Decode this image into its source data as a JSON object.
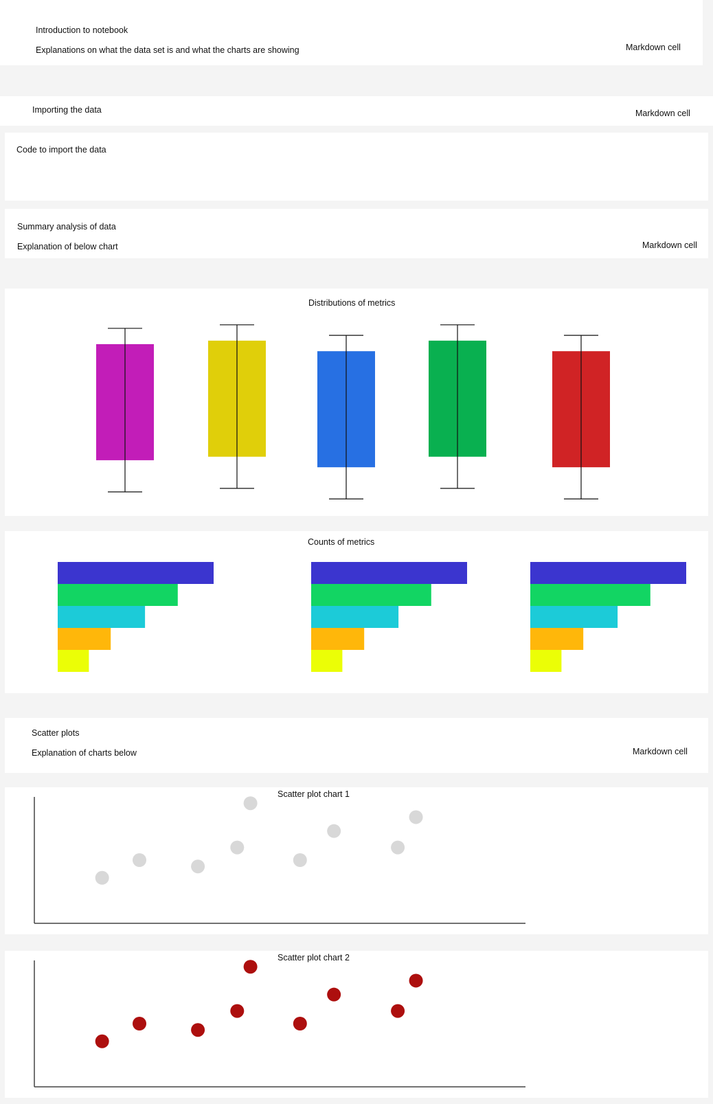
{
  "cells": {
    "intro": {
      "title": "Introduction to notebook",
      "body": "Explanations on what the data set is and what the charts are showing",
      "cell_type": "Markdown cell"
    },
    "import_md": {
      "title": "Importing the data",
      "cell_type": "Markdown cell"
    },
    "import_code": {
      "body": "Code to import the data"
    },
    "summary": {
      "title": "Summary analysis of data",
      "body": "Explanation of below chart",
      "cell_type": "Markdown cell"
    },
    "scatter_md": {
      "title": "Scatter plots",
      "body": "Explanation of charts below",
      "cell_type": "Markdown cell"
    }
  },
  "chart_data": [
    {
      "type": "boxplot",
      "title": "Distributions of metrics",
      "series": [
        {
          "color": "#c21db8",
          "whisker_high": 0.93,
          "q3": 0.84,
          "q1": 0.18,
          "whisker_low": 0.0
        },
        {
          "color": "#e0cf0a",
          "whisker_high": 0.95,
          "q3": 0.86,
          "q1": 0.2,
          "whisker_low": 0.02
        },
        {
          "color": "#2770e3",
          "whisker_high": 0.89,
          "q3": 0.8,
          "q1": 0.14,
          "whisker_low": -0.04
        },
        {
          "color": "#09b050",
          "whisker_high": 0.95,
          "q3": 0.86,
          "q1": 0.2,
          "whisker_low": 0.02
        },
        {
          "color": "#d02325",
          "whisker_high": 0.89,
          "q3": 0.8,
          "q1": 0.14,
          "whisker_low": -0.04
        }
      ]
    },
    {
      "type": "bar",
      "title": "Counts of metrics",
      "orientation": "horizontal",
      "colors": [
        "#3b35cf",
        "#12d563",
        "#1ccbd8",
        "#ffb70a",
        "#ebfe06"
      ],
      "panels": [
        {
          "values": [
            100,
            77,
            56,
            34,
            20
          ]
        },
        {
          "values": [
            100,
            77,
            56,
            34,
            20
          ]
        },
        {
          "values": [
            100,
            77,
            56,
            34,
            20
          ]
        }
      ]
    },
    {
      "type": "scatter",
      "title": "Scatter plot chart 1",
      "color": "#d8d8d8",
      "points": [
        {
          "x": 0.138,
          "y": 0.36
        },
        {
          "x": 0.214,
          "y": 0.5
        },
        {
          "x": 0.333,
          "y": 0.45
        },
        {
          "x": 0.413,
          "y": 0.6
        },
        {
          "x": 0.44,
          "y": 0.95
        },
        {
          "x": 0.541,
          "y": 0.5
        },
        {
          "x": 0.61,
          "y": 0.73
        },
        {
          "x": 0.74,
          "y": 0.6
        },
        {
          "x": 0.777,
          "y": 0.84
        }
      ]
    },
    {
      "type": "scatter",
      "title": "Scatter plot chart 2",
      "color": "#ad0f0e",
      "points": [
        {
          "x": 0.138,
          "y": 0.36
        },
        {
          "x": 0.214,
          "y": 0.5
        },
        {
          "x": 0.333,
          "y": 0.45
        },
        {
          "x": 0.413,
          "y": 0.6
        },
        {
          "x": 0.44,
          "y": 0.95
        },
        {
          "x": 0.541,
          "y": 0.5
        },
        {
          "x": 0.61,
          "y": 0.73
        },
        {
          "x": 0.74,
          "y": 0.6
        },
        {
          "x": 0.777,
          "y": 0.84
        }
      ]
    }
  ]
}
